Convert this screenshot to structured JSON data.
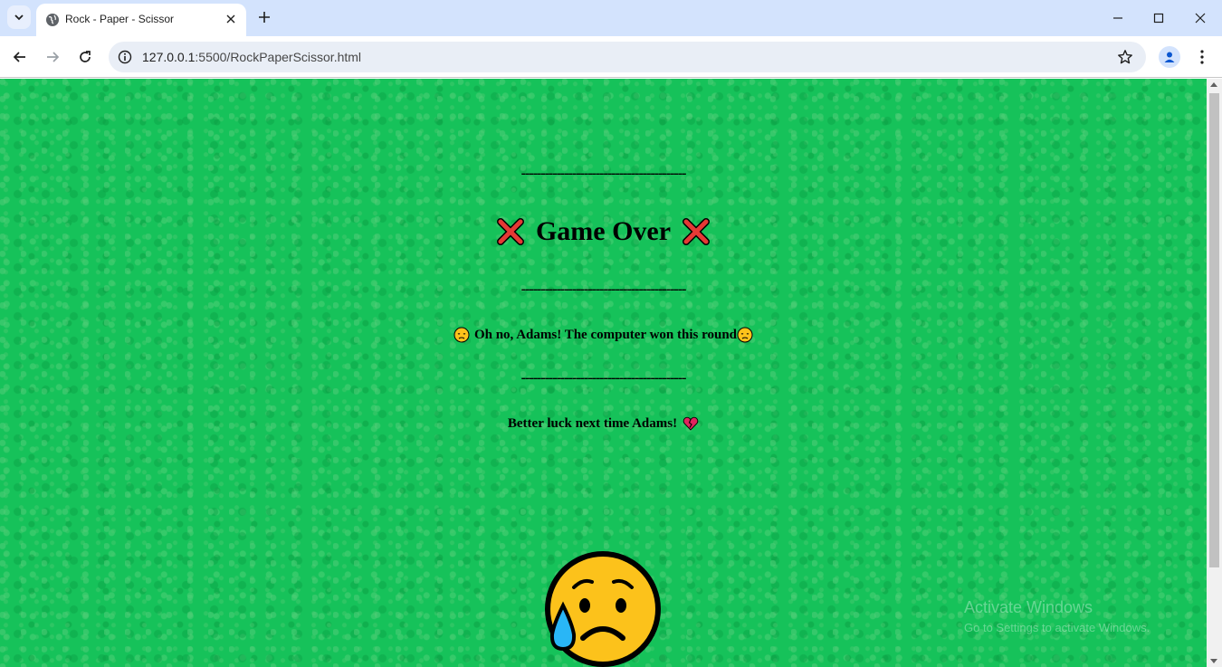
{
  "browser": {
    "tab_title": "Rock - Paper - Scissor",
    "url_host": "127.0.0.1",
    "url_path": ":5500/RockPaperScissor.html"
  },
  "game": {
    "divider": "------------------------------------------",
    "title": "Game Over",
    "title_icon": "cross-mark-icon",
    "message": "Oh no, Adams! The computer won this round",
    "message_icon": "disappointed-face-icon",
    "encouragement": "Better luck next time Adams!",
    "encouragement_icon": "broken-heart-icon",
    "result_icon": "sad-sweat-face-icon"
  },
  "os_watermark": {
    "title": "Activate Windows",
    "subtitle": "Go to Settings to activate Windows."
  },
  "colors": {
    "page_background": "#16c25a",
    "tabstrip_background": "#d3e3fd"
  }
}
